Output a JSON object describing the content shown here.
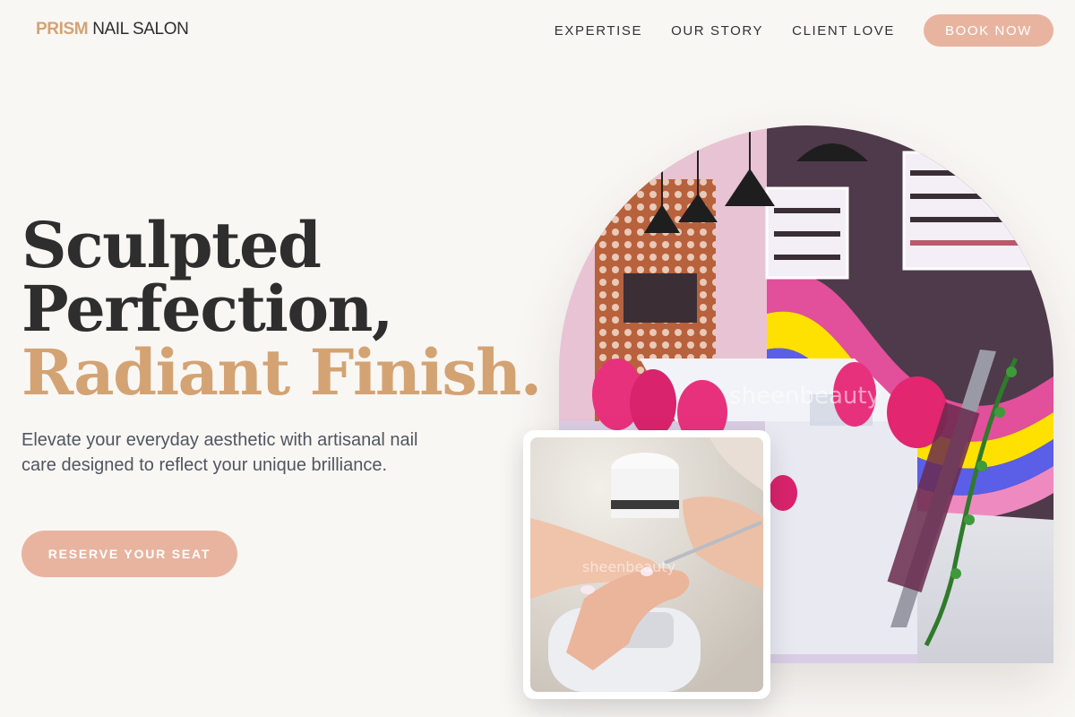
{
  "header": {
    "logo_brand": "PRISM",
    "logo_rest": "NAIL SALON",
    "nav": [
      {
        "label": "EXPERTISE"
      },
      {
        "label": "OUR STORY"
      },
      {
        "label": "CLIENT LOVE"
      }
    ],
    "cta_label": "BOOK NOW"
  },
  "hero": {
    "title_line1": "Sculpted",
    "title_line2": "Perfection,",
    "title_line3": "Radiant Finish.",
    "description": "Elevate your everyday aesthetic with artisanal nail care designed to reflect your unique brilliance.",
    "cta_label": "RESERVE YOUR SEAT"
  },
  "images": {
    "main_watermark": "sheenbeauty",
    "inset_watermark": "sheenbeauty"
  },
  "colors": {
    "accent": "#d4a373",
    "button": "#e8b4a0",
    "background": "#f9f7f4",
    "text": "#2e2e2e"
  }
}
